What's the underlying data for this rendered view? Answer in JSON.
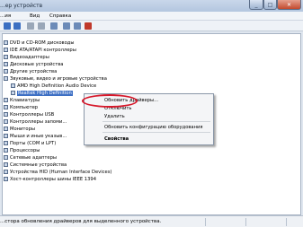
{
  "window": {
    "title": "...ер устройств"
  },
  "menu": [
    "...ия",
    "Вид",
    "Справка"
  ],
  "tree": [
    "DVD и CD-ROM дисководы",
    "IDE ATA/ATAPI контроллеры",
    "Видеоадаптеры",
    "Дисковые устройства",
    "Другие устройства",
    "Звуковые, видео и игровые устройства",
    "AMD High Definition Audio Device",
    "Realtek High Definition",
    "Клавиатуры",
    "Компьютер",
    "Контроллеры USB",
    "Контроллеры запоми...",
    "Мониторы",
    "Мыши и иные указыв...",
    "Порты (COM и LPT)",
    "Процессоры",
    "Сетевые адаптеры",
    "Системные устройства",
    "Устройства HID (Human Interface Devices)",
    "Хост-контроллеры шины IEEE 1394"
  ],
  "context_menu": {
    "update": "Обновить драйверы...",
    "disable": "Отключить",
    "delete": "Удалить",
    "scan": "Обновить конфигурацию оборудования",
    "properties": "Свойства"
  },
  "status": {
    "text": "...стора обновления драйверов для выделенного устройства."
  },
  "colors": {
    "highlight": "#d6182a",
    "selection": "#3d6fc4"
  }
}
